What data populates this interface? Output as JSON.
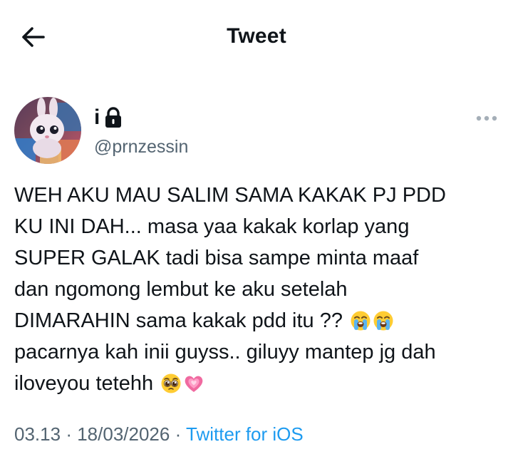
{
  "header": {
    "title": "Tweet",
    "back_icon": "arrow-left-icon"
  },
  "author": {
    "display_name": "i",
    "handle": "@prnzessin",
    "protected_icon": "lock-icon",
    "more_icon": "more-horizontal-icon"
  },
  "tweet": {
    "lines": [
      "WEH AKU MAU SALIM SAMA KAKAK PJ PDD",
      "KU INI DAH... masa yaa kakak korlap yang",
      "SUPER GALAK tadi bisa sampe minta maaf",
      "dan ngomong lembut ke aku setelah",
      "DIMARAHIN sama kakak pdd itu ??",
      "pacarnya kah inii guyss.. giluyy mantep jg dah",
      "iloveyou tetehh"
    ],
    "emojis": {
      "line5": [
        "loudly-crying-face",
        "loudly-crying-face"
      ],
      "line7": [
        "pleading-face",
        "growing-heart"
      ]
    }
  },
  "meta": {
    "time": "03.13",
    "separator": "·",
    "date": "18/03/2026",
    "source": "Twitter for iOS"
  },
  "colors": {
    "text": "#0f1419",
    "secondary": "#536471",
    "link": "#1d9bf0"
  }
}
